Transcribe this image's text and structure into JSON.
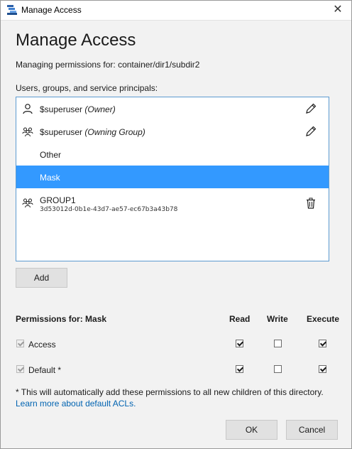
{
  "window": {
    "title": "Manage Access",
    "close_glyph": "✕",
    "app_icon": "storage-explorer-icon"
  },
  "heading": "Manage Access",
  "managing": "Managing permissions for: container/dir1/subdir2",
  "principals_label": "Users, groups, and service principals:",
  "principals": [
    {
      "name": "$superuser",
      "role": "(Owner)",
      "icon": "user-icon",
      "action": "edit-icon",
      "selected": false
    },
    {
      "name": "$superuser",
      "role": "(Owning Group)",
      "icon": "group-icon",
      "action": "edit-icon",
      "selected": false
    },
    {
      "name": "Other",
      "role": "",
      "icon": "",
      "action": "",
      "selected": false
    },
    {
      "name": "Mask",
      "role": "",
      "icon": "",
      "action": "",
      "selected": true
    },
    {
      "name": "GROUP1",
      "id": "3d53012d-0b1e-43d7-ae57-ec67b3a43b78",
      "icon": "group-icon",
      "action": "delete-icon",
      "selected": false
    }
  ],
  "add_button": "Add",
  "permissions": {
    "header": "Permissions for: Mask",
    "columns": [
      "Read",
      "Write",
      "Execute"
    ],
    "rows": [
      {
        "label": "Access",
        "enabled": true,
        "read": true,
        "write": false,
        "execute": true
      },
      {
        "label": "Default *",
        "enabled": true,
        "read": true,
        "write": false,
        "execute": true
      }
    ]
  },
  "note": "* This will automatically add these permissions to all new children of this directory.",
  "learn_more": "Learn more about default ACLs.",
  "ok_button": "OK",
  "cancel_button": "Cancel",
  "colors": {
    "selection": "#3399ff",
    "link": "#0063b1",
    "list_border": "#5c9bd1"
  }
}
